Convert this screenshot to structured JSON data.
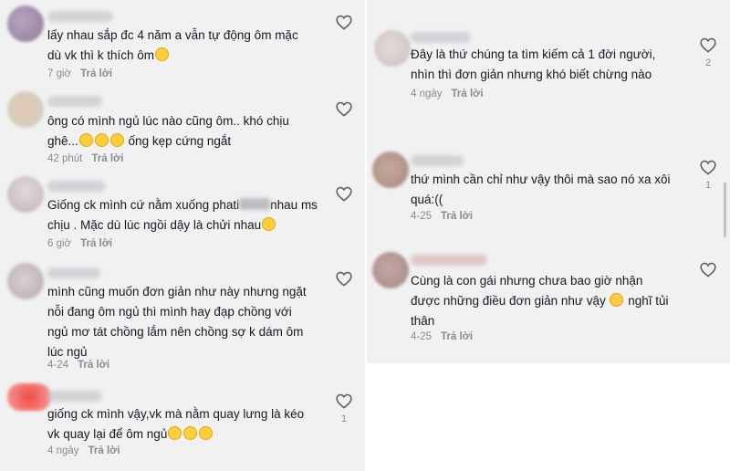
{
  "colors": {
    "panel_bg": "#f1f1f2",
    "text": "#161823",
    "meta": "#8a8b91",
    "heart_outline": "#5a5b60"
  },
  "left_comments": [
    {
      "text": "lấy nhau sắp đc 4 năm a vẫn tự động ôm mặc\ndù vk thì k thích ôm",
      "emoji": [
        "grinning-sweat-emoji"
      ],
      "time": "7 giờ",
      "reply": "Trả lời",
      "likes": ""
    },
    {
      "text": "ông có mình ngủ lúc nào cũng ôm.. khó chịu\nghê...",
      "emoji_after": "ống kẹp cứng ngắt",
      "time": "42 phút",
      "reply": "Trả lời",
      "likes": ""
    },
    {
      "text_before": "Giống ck mình cứ nằm xuống phati",
      "text_after": "nhau ms\nchịu . Mặc dù lúc ngồi dậy là chửi nhau",
      "time": "6 giờ",
      "reply": "Trả lời",
      "likes": ""
    },
    {
      "text": "mình cũng muốn đơn giản như này nhưng ngặt\nnỗi đang ôm ngủ thì mình hay đạp chồng với\nngủ mơ tát chồng lắm nên chồng sợ k dám ôm\nlúc ngủ",
      "time": "4-24",
      "reply": "Trả lời",
      "likes": ""
    },
    {
      "text": "giống ck mình vậy,vk mà nằm quay lưng là kéo\nvk quay lại để ôm ngủ",
      "time": "4 ngày",
      "reply": "Trả lời",
      "likes": "1"
    }
  ],
  "right_comments": [
    {
      "text": "Đây là thứ chúng ta tìm kiếm cả 1 đời người,\nnhìn thì đơn giản nhưng khó biết chừng nào",
      "time": "4 ngày",
      "reply": "Trả lời",
      "likes": "2"
    },
    {
      "text": "thứ mình cần chỉ như vậy thôi mà sao nó xa xôi\nquá:((",
      "time": "4-25",
      "reply": "Trả lời",
      "likes": "1"
    },
    {
      "text_before": "Cùng là con gái nhưng chưa bao giờ nhận\nđược những điều đơn giản như vậy",
      "text_after": "nghĩ tủi\nthân",
      "time": "4-25",
      "reply": "Trả lời",
      "likes": ""
    }
  ]
}
